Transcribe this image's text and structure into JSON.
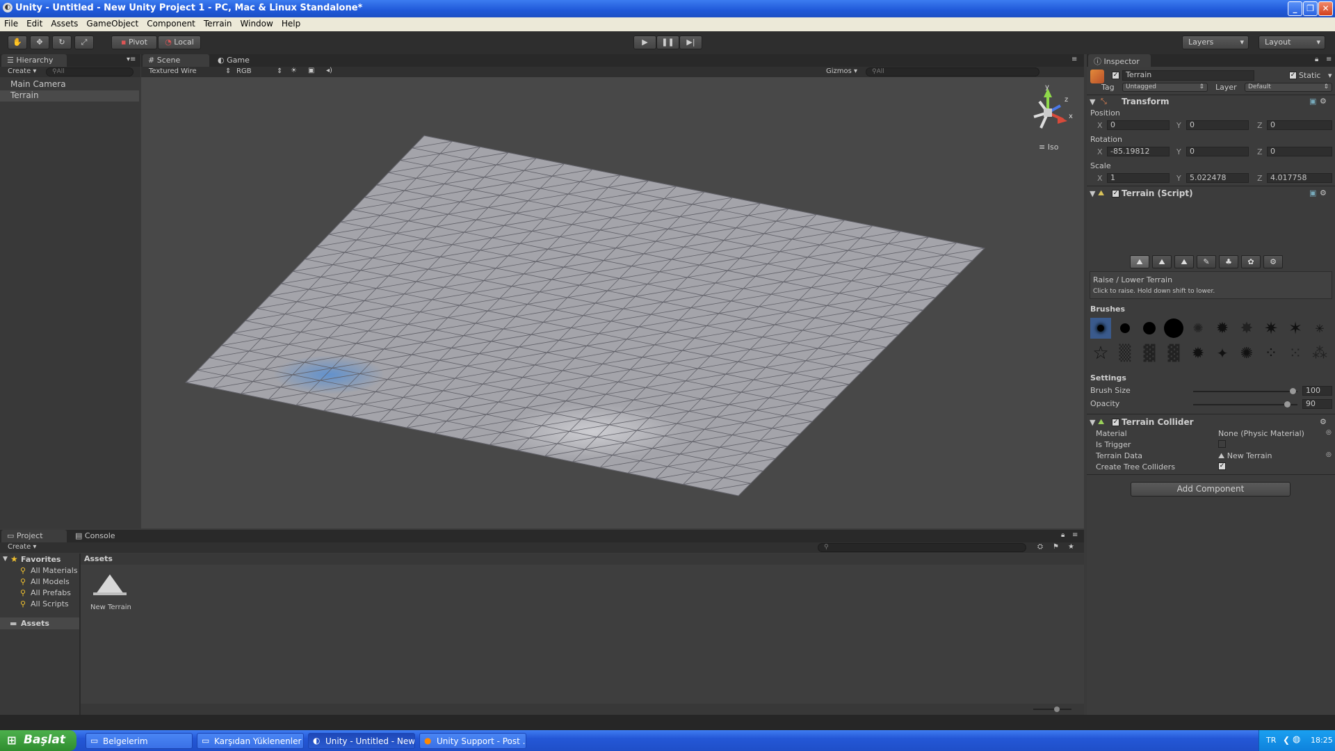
{
  "window": {
    "title": "Unity - Untitled - New Unity Project 1 - PC, Mac & Linux Standalone*",
    "controls": [
      "_",
      "❐",
      "✕"
    ]
  },
  "menubar": [
    "File",
    "Edit",
    "Assets",
    "GameObject",
    "Component",
    "Terrain",
    "Window",
    "Help"
  ],
  "toolbar": {
    "pivot_label": "Pivot",
    "local_label": "Local",
    "layers_label": "Layers",
    "layout_label": "Layout"
  },
  "hierarchy": {
    "tab_label": "Hierarchy",
    "create_label": "Create",
    "search_placeholder": "All",
    "items": [
      "Main Camera",
      "Terrain"
    ],
    "selected": "Terrain"
  },
  "scene": {
    "tabs": [
      "Scene",
      "Game"
    ],
    "active_tab": "Scene",
    "render_mode": "Textured Wire",
    "color_mode": "RGB",
    "gizmos_label": "Gizmos",
    "search_placeholder": "All",
    "view_label": "Iso",
    "axis_labels": {
      "y": "y",
      "z": "z",
      "x": "x"
    }
  },
  "inspector": {
    "tab_label": "Inspector",
    "object_name": "Terrain",
    "static_label": "Static",
    "tag_label": "Tag",
    "tag_value": "Untagged",
    "layer_label": "Layer",
    "layer_value": "Default",
    "transform": {
      "title": "Transform",
      "position_label": "Position",
      "position": {
        "x": "0",
        "y": "0",
        "z": "0"
      },
      "rotation_label": "Rotation",
      "rotation": {
        "x": "-85.19812",
        "y": "0",
        "z": "0"
      },
      "scale_label": "Scale",
      "scale": {
        "x": "1",
        "y": "5.022478",
        "z": "4.017758"
      }
    },
    "terrain_script": {
      "title": "Terrain (Script)",
      "tool_title": "Raise / Lower Terrain",
      "tool_hint": "Click to raise. Hold down shift to lower.",
      "brushes_label": "Brushes",
      "settings_label": "Settings",
      "brush_size_label": "Brush Size",
      "brush_size_value": "100",
      "brush_size_fraction": 0.95,
      "opacity_label": "Opacity",
      "opacity_value": "90",
      "opacity_fraction": 0.9
    },
    "terrain_collider": {
      "title": "Terrain Collider",
      "material_label": "Material",
      "material_value": "None (Physic Material)",
      "is_trigger_label": "Is Trigger",
      "is_trigger": false,
      "terrain_data_label": "Terrain Data",
      "terrain_data_value": "New Terrain",
      "create_tree_label": "Create Tree Colliders",
      "create_tree": true
    },
    "add_component_label": "Add Component"
  },
  "project": {
    "tabs": [
      "Project",
      "Console"
    ],
    "active_tab": "Project",
    "create_label": "Create",
    "favorites_label": "Favorites",
    "favorites": [
      "All Materials",
      "All Models",
      "All Prefabs",
      "All Scripts"
    ],
    "assets_folder_label": "Assets",
    "assets_header": "Assets",
    "asset_items": [
      "New Terrain"
    ]
  },
  "taskbar": {
    "start_label": "Başlat",
    "tasks": [
      "Belgelerim",
      "Karşıdan Yüklenenler",
      "Unity - Untitled - New...",
      "Unity Support - Post ..."
    ],
    "language": "TR",
    "clock": "18:25"
  }
}
